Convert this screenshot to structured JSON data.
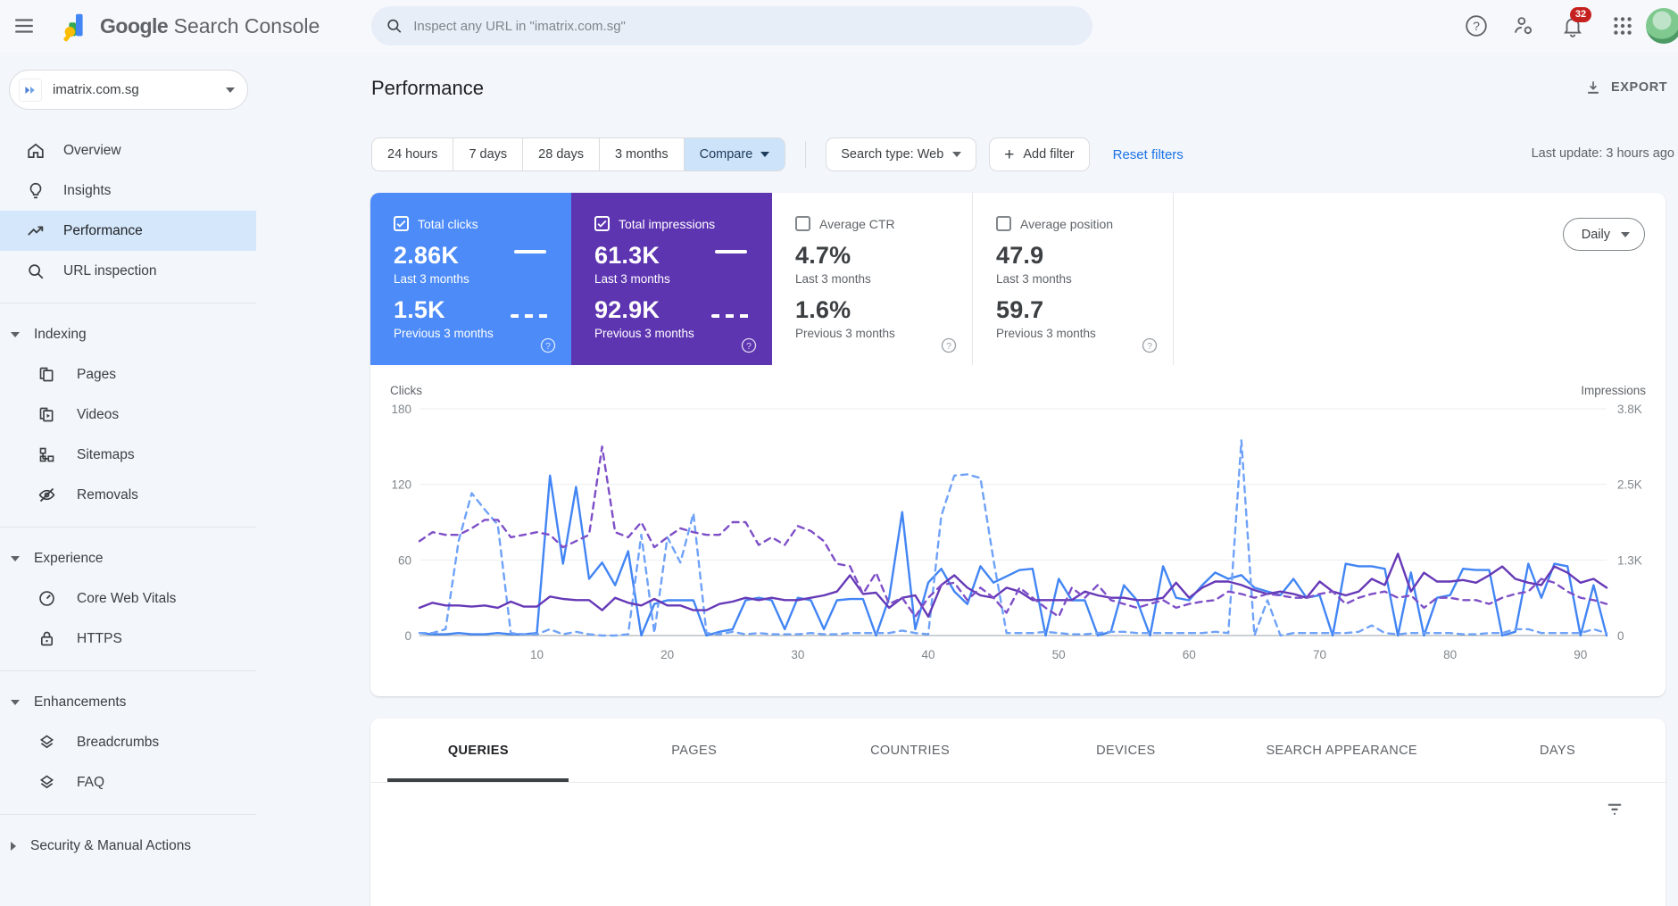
{
  "topbar": {
    "product_name_primary": "Google",
    "product_name_secondary": "Search Console",
    "search_placeholder": "Inspect any URL in \"imatrix.com.sg\"",
    "notification_count": "32"
  },
  "sidebar": {
    "property": {
      "name": "imatrix.com.sg"
    },
    "primary": [
      {
        "label": "Overview",
        "icon": "home-icon"
      },
      {
        "label": "Insights",
        "icon": "lightbulb-icon"
      },
      {
        "label": "Performance",
        "icon": "trend-icon",
        "active": true
      },
      {
        "label": "URL inspection",
        "icon": "magnifier-icon"
      }
    ],
    "sections": [
      {
        "header": "Indexing",
        "expanded": true,
        "items": [
          {
            "label": "Pages",
            "icon": "pages-icon"
          },
          {
            "label": "Videos",
            "icon": "video-icon"
          },
          {
            "label": "Sitemaps",
            "icon": "sitemap-icon"
          },
          {
            "label": "Removals",
            "icon": "eye-off-icon"
          }
        ]
      },
      {
        "header": "Experience",
        "expanded": true,
        "items": [
          {
            "label": "Core Web Vitals",
            "icon": "speedometer-icon"
          },
          {
            "label": "HTTPS",
            "icon": "lock-icon"
          }
        ]
      },
      {
        "header": "Enhancements",
        "expanded": true,
        "items": [
          {
            "label": "Breadcrumbs",
            "icon": "layers-icon"
          },
          {
            "label": "FAQ",
            "icon": "layers-icon"
          }
        ]
      },
      {
        "header": "Security & Manual Actions",
        "expanded": false,
        "items": []
      }
    ]
  },
  "header": {
    "title": "Performance",
    "export_label": "EXPORT"
  },
  "filters": {
    "date_options": [
      "24 hours",
      "7 days",
      "28 days",
      "3 months"
    ],
    "compare_label": "Compare",
    "search_type_label": "Search type: Web",
    "add_filter_label": "Add filter",
    "reset_label": "Reset filters",
    "last_update": "Last update: 3 hours ago"
  },
  "metrics": {
    "granularity": "Daily",
    "cards": [
      {
        "label": "Total clicks",
        "checked": true,
        "color": "#4c8bf8",
        "value_current": "2.86K",
        "caption_current": "Last 3 months",
        "value_previous": "1.5K",
        "caption_previous": "Previous 3 months"
      },
      {
        "label": "Total impressions",
        "checked": true,
        "color": "#5e35b1",
        "value_current": "61.3K",
        "caption_current": "Last 3 months",
        "value_previous": "92.9K",
        "caption_previous": "Previous 3 months"
      },
      {
        "label": "Average CTR",
        "checked": false,
        "color": "#ffffff",
        "value_current": "4.7%",
        "caption_current": "Last 3 months",
        "value_previous": "1.6%",
        "caption_previous": "Previous 3 months"
      },
      {
        "label": "Average position",
        "checked": false,
        "color": "#ffffff",
        "value_current": "47.9",
        "caption_current": "Last 3 months",
        "value_previous": "59.7",
        "caption_previous": "Previous 3 months"
      }
    ]
  },
  "chart_data": {
    "type": "line",
    "ylabel_left": "Clicks",
    "ylabel_right": "Impressions",
    "left_max": 180,
    "right_max": 3840,
    "y_left_ticks": [
      0,
      60,
      120,
      180
    ],
    "y_left_labels": [
      "0",
      "60",
      "120",
      "180"
    ],
    "y_right_labels": [
      "0",
      "1.3K",
      "2.5K",
      "3.8K"
    ],
    "x_range": [
      1,
      92
    ],
    "x_ticks": [
      10,
      20,
      30,
      40,
      50,
      60,
      70,
      80,
      90
    ],
    "grid": "horizontal-only",
    "legend": "hidden",
    "series": [
      {
        "name": "Clicks - Last 3 months",
        "axis": "left",
        "style": "solid",
        "color": "#4285f4",
        "values": [
          2,
          1,
          1,
          2,
          1,
          1,
          2,
          1,
          1,
          2,
          127,
          57,
          118,
          45,
          58,
          40,
          67,
          0,
          25,
          28,
          28,
          28,
          0,
          3,
          5,
          28,
          30,
          28,
          5,
          30,
          28,
          5,
          28,
          29,
          29,
          0,
          30,
          98,
          5,
          42,
          53,
          35,
          25,
          55,
          42,
          47,
          52,
          53,
          0,
          45,
          28,
          28,
          0,
          3,
          40,
          28,
          0,
          55,
          30,
          28,
          40,
          50,
          45,
          48,
          38,
          35,
          32,
          45,
          30,
          32,
          0,
          57,
          55,
          55,
          53,
          0,
          50,
          0,
          30,
          32,
          53,
          52,
          52,
          0,
          3,
          57,
          30,
          57,
          55,
          0,
          40,
          0
        ]
      },
      {
        "name": "Clicks - Previous 3 months",
        "axis": "left",
        "style": "dashed",
        "color": "#6fa2f8",
        "values": [
          2,
          2,
          5,
          75,
          113,
          100,
          88,
          2,
          1,
          1,
          5,
          1,
          3,
          1,
          0,
          0,
          1,
          80,
          2,
          78,
          58,
          97,
          2,
          1,
          3,
          1,
          2,
          1,
          1,
          1,
          2,
          1,
          1,
          2,
          2,
          2,
          2,
          4,
          2,
          1,
          95,
          127,
          128,
          125,
          60,
          2,
          2,
          2,
          3,
          2,
          1,
          1,
          2,
          3,
          3,
          2,
          2,
          2,
          2,
          2,
          2,
          3,
          2,
          155,
          0,
          28,
          0,
          2,
          2,
          2,
          2,
          2,
          3,
          8,
          2,
          1,
          2,
          2,
          2,
          2,
          1,
          1,
          2,
          2,
          5,
          5,
          2,
          2,
          2,
          2,
          5,
          2
        ]
      },
      {
        "name": "Impressions - Last 3 months",
        "axis": "right",
        "style": "solid",
        "color": "#6639b7",
        "values": [
          470,
          555,
          510,
          510,
          490,
          510,
          470,
          575,
          490,
          490,
          660,
          620,
          600,
          600,
          430,
          640,
          555,
          510,
          620,
          510,
          510,
          430,
          430,
          535,
          575,
          640,
          600,
          640,
          600,
          600,
          640,
          680,
          745,
          1020,
          705,
          725,
          470,
          640,
          680,
          320,
          855,
          1020,
          810,
          680,
          640,
          810,
          745,
          600,
          600,
          600,
          600,
          745,
          680,
          640,
          640,
          600,
          600,
          640,
          895,
          640,
          810,
          915,
          915,
          855,
          770,
          705,
          745,
          705,
          640,
          915,
          745,
          680,
          745,
          960,
          855,
          1385,
          745,
          1065,
          915,
          915,
          940,
          895,
          1020,
          1170,
          960,
          895,
          855,
          1170,
          1065,
          895,
          960,
          810
        ]
      },
      {
        "name": "Impressions - Previous 3 months",
        "axis": "right",
        "style": "dashed",
        "color": "#7e4fc7",
        "values": [
          1600,
          1750,
          1705,
          1705,
          1815,
          1960,
          1960,
          1665,
          1705,
          1750,
          1705,
          1495,
          1600,
          1705,
          3200,
          1750,
          1665,
          1920,
          1495,
          1665,
          1815,
          1750,
          1705,
          1705,
          1920,
          1920,
          1535,
          1665,
          1535,
          1855,
          1770,
          1600,
          1215,
          1175,
          705,
          1065,
          535,
          640,
          320,
          640,
          855,
          895,
          600,
          810,
          640,
          385,
          810,
          640,
          470,
          320,
          810,
          640,
          855,
          600,
          535,
          470,
          535,
          600,
          470,
          535,
          575,
          600,
          745,
          705,
          640,
          705,
          680,
          640,
          640,
          705,
          745,
          535,
          640,
          705,
          745,
          640,
          680,
          470,
          640,
          640,
          600,
          600,
          535,
          640,
          705,
          745,
          960,
          895,
          745,
          640,
          600,
          535
        ]
      }
    ]
  },
  "tabs": {
    "items": [
      "QUERIES",
      "PAGES",
      "COUNTRIES",
      "DEVICES",
      "SEARCH APPEARANCE",
      "DAYS"
    ],
    "active": "QUERIES"
  }
}
